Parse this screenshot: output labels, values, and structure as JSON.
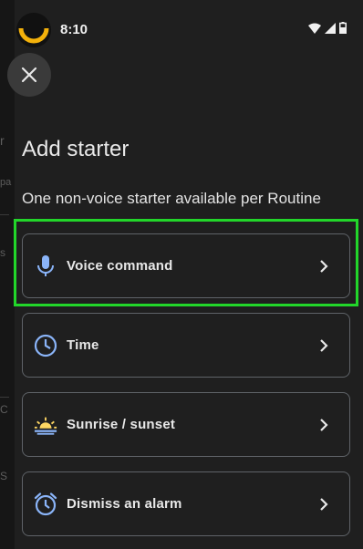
{
  "status_bar": {
    "time": "8:10"
  },
  "dialog": {
    "title": "Add starter",
    "subtitle": "One non-voice starter available per Routine",
    "options": [
      {
        "label": "Voice command",
        "icon": "mic-icon"
      },
      {
        "label": "Time",
        "icon": "clock-icon"
      },
      {
        "label": "Sunrise / sunset",
        "icon": "sunrise-icon"
      },
      {
        "label": "Dismiss an alarm",
        "icon": "alarm-icon"
      }
    ]
  },
  "background_fragments": [
    "r",
    "pa",
    "s",
    "C",
    "S"
  ],
  "colors": {
    "accent_icon": "#8ab4f8",
    "sun": "#fdd663",
    "highlight": "#22d62a",
    "surface": "#1f1f1f"
  }
}
